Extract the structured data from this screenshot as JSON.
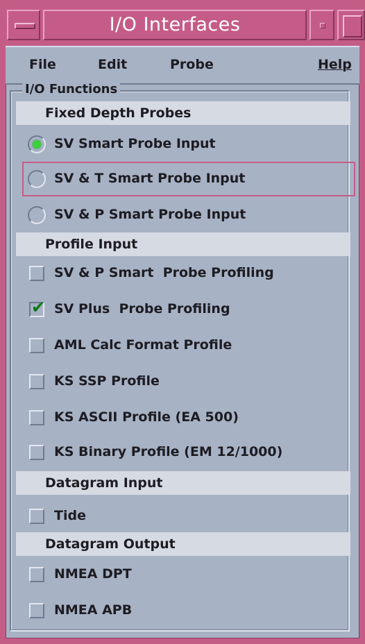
{
  "window": {
    "title": "I/O Interfaces"
  },
  "menu": {
    "file": "File",
    "edit": "Edit",
    "probe": "Probe",
    "help": "Help"
  },
  "group": {
    "legend": "I/O Functions"
  },
  "sections": {
    "fixed_depth": "Fixed Depth Probes",
    "profile_input": "Profile Input",
    "datagram_input": "Datagram Input",
    "datagram_output": "Datagram Output"
  },
  "fixed_depth_options": [
    {
      "label": "SV Smart Probe Input",
      "selected": true
    },
    {
      "label": "SV & T Smart Probe Input",
      "selected": false
    },
    {
      "label": "SV & P Smart Probe Input",
      "selected": false
    }
  ],
  "profile_options": [
    {
      "label": "SV & P Smart  Probe Profiling",
      "checked": false
    },
    {
      "label": "SV Plus  Probe Profiling",
      "checked": true
    },
    {
      "label": "AML Calc Format Profile",
      "checked": false
    },
    {
      "label": "KS SSP Profile",
      "checked": false
    },
    {
      "label": "KS ASCII Profile (EA 500)",
      "checked": false
    },
    {
      "label": "KS Binary Profile (EM 12/1000)",
      "checked": false
    }
  ],
  "datagram_input_options": [
    {
      "label": "Tide",
      "checked": false
    }
  ],
  "datagram_output_options": [
    {
      "label": "NMEA DPT",
      "checked": false
    },
    {
      "label": "NMEA APB",
      "checked": false
    }
  ],
  "icons": {
    "check_mark": "✔"
  },
  "colors": {
    "title_bar": "#c55c88",
    "window_bg": "#a8b2c5",
    "section_bg": "#d6dae3",
    "radio_selected": "#3bd13b",
    "check_mark": "#0b7a14",
    "focus_ring": "#c45d86"
  }
}
